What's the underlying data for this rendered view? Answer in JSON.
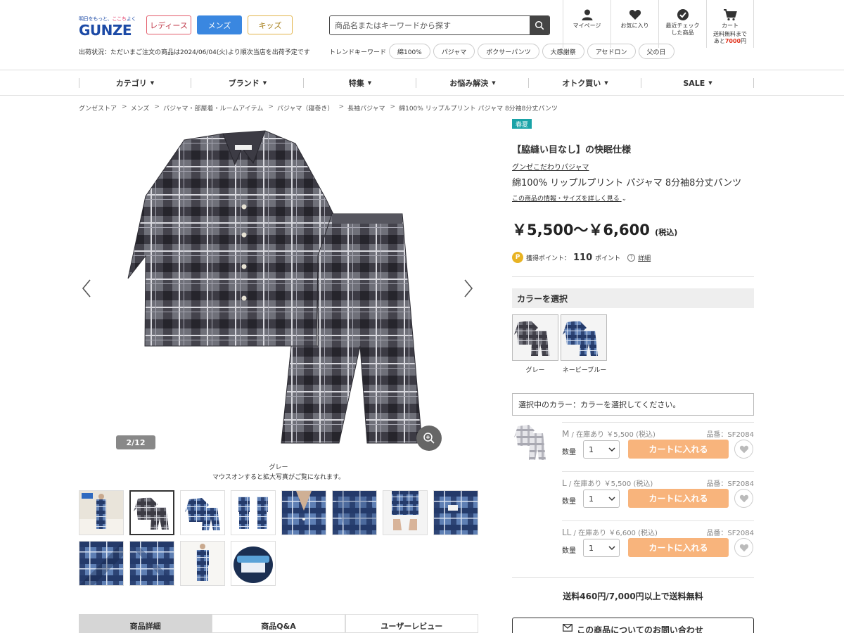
{
  "header": {
    "logo_tagline_a": "明日をもっと、",
    "logo_tagline_b": "ここち",
    "logo_tagline_c": "よく",
    "logo_text": "GUNZE",
    "genders": [
      "レディース",
      "メンズ",
      "キッズ"
    ],
    "shipping_status": "出荷状況：ただいまご注文の商品は2024/06/04(火)より順次当店を出荷予定です",
    "search_placeholder": "商品名またはキーワードから探す",
    "trend_label": "トレンドキーワード",
    "trend_keywords": [
      "綿100%",
      "パジャマ",
      "ボクサーパンツ",
      "大感謝祭",
      "アセドロン",
      "父の日"
    ],
    "utility": {
      "mypage": "マイページ",
      "favorites": "お気に入り",
      "recent_line1": "最近チェック",
      "recent_line2": "した商品",
      "cart": "カート",
      "cart_note_line1": "送料無料まで",
      "cart_note_prefix": "あと",
      "cart_note_amount": "7000",
      "cart_note_suffix": "円"
    }
  },
  "nav": [
    "カテゴリ",
    "ブランド",
    "特集",
    "お悩み解決",
    "オトク買い",
    "SALE"
  ],
  "breadcrumb": [
    "グンゼストア",
    "メンズ",
    "パジャマ・部屋着・ルームアイテム",
    "パジャマ（寝巻き）",
    "長袖パジャマ",
    "綿100% リップルプリント パジャマ 8分袖8分丈パンツ"
  ],
  "gallery": {
    "counter": "2/12",
    "caption_color": "グレー",
    "caption_hint": "マウスオンすると拡大写真がご覧になれます。",
    "thumb_count": 12,
    "active_index": 1
  },
  "tabs": [
    "商品詳細",
    "商品Q&A",
    "ユーザーレビュー"
  ],
  "product": {
    "season_badge": "春夏",
    "catch": "【脇縫い目なし】の快眠仕様",
    "series_link": "グンゼこだわりパジャマ",
    "name": "綿100% リップルプリント パジャマ 8分袖8分丈パンツ",
    "detail_link": "この商品の情報・サイズを詳しく見る",
    "price": "￥5,500〜￥6,600",
    "price_tax": "(税込)",
    "points_label": "獲得ポイント：",
    "points_value": "110",
    "points_unit": "ポイント",
    "points_detail": "詳細",
    "color_heading": "カラーを選択",
    "colors": [
      "グレー",
      "ネービーブルー"
    ],
    "selected_color_text": "選択中のカラー：カラーを選択してください。",
    "sizes": [
      {
        "size": "M",
        "stock": "在庫あり",
        "price": "￥5,500",
        "tax": "(税込)",
        "code": "品番：SF2084",
        "qty_label": "数量",
        "qty": "1",
        "cart_label": "カートに入れる"
      },
      {
        "size": "L",
        "stock": "在庫あり",
        "price": "￥5,500",
        "tax": "(税込)",
        "code": "品番：SF2084",
        "qty_label": "数量",
        "qty": "1",
        "cart_label": "カートに入れる"
      },
      {
        "size": "LL",
        "stock": "在庫あり",
        "price": "￥6,600",
        "tax": "(税込)",
        "code": "品番：SF2084",
        "qty_label": "数量",
        "qty": "1",
        "cart_label": "カートに入れる"
      }
    ],
    "shipping_note": "送料460円/7,000円以上で送料無料",
    "inquiry": "この商品についてのお問い合わせ"
  },
  "colors": {
    "brand_blue": "#1c4aa6",
    "mens_blue": "#3a87e0",
    "cart_orange": "#f8b47c",
    "season_teal": "#19a3a7",
    "point_gold": "#e8b323"
  }
}
